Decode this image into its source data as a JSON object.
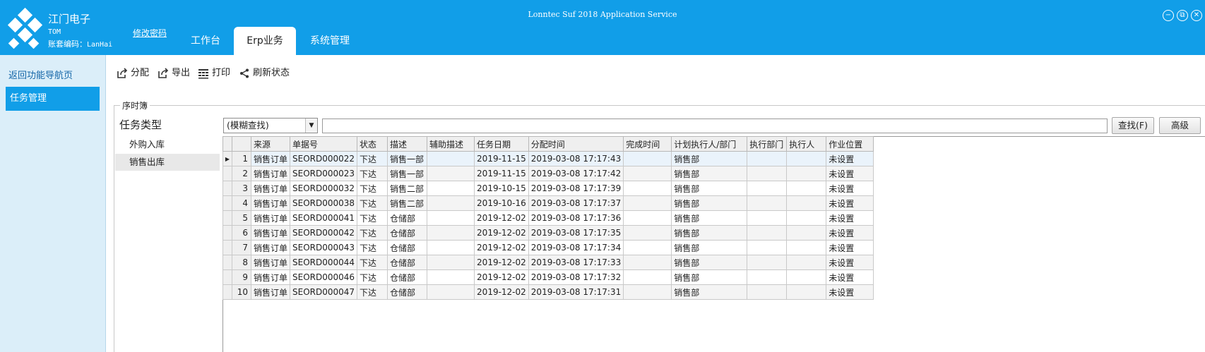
{
  "header": {
    "company": "江门电子",
    "user": "TOM",
    "account_label": "账套编码：",
    "account_code": "LanHai",
    "change_password": "修改密码",
    "app_title": "Lonntec Suf 2018 Application Service",
    "tabs": [
      {
        "label": "工作台",
        "active": false
      },
      {
        "label": "Erp业务",
        "active": true
      },
      {
        "label": "系统管理",
        "active": false
      }
    ],
    "window_buttons": {
      "minimize": "−",
      "restore": "⧉",
      "close": "✕"
    }
  },
  "leftnav": {
    "back": "返回功能导航页",
    "active_item": "任务管理"
  },
  "toolbar": {
    "items": [
      {
        "label": "分配",
        "icon": "share-icon"
      },
      {
        "label": "导出",
        "icon": "export-icon"
      },
      {
        "label": "打印",
        "icon": "print-icon"
      },
      {
        "label": "刷新状态",
        "icon": "refresh-share-icon"
      }
    ]
  },
  "group": {
    "title": "序时簿",
    "task_type_title": "任务类型",
    "task_types": [
      {
        "label": "外购入库",
        "selected": false
      },
      {
        "label": "销售出库",
        "selected": true
      }
    ]
  },
  "search": {
    "mode": "(模糊查找)",
    "value": "",
    "find_button": "查找(F)",
    "advanced_button": "高级"
  },
  "grid": {
    "columns": [
      "来源",
      "单据号",
      "状态",
      "描述",
      "辅助描述",
      "任务日期",
      "分配时间",
      "完成时间",
      "计划执行人/部门",
      "执行部门",
      "执行人",
      "作业位置"
    ],
    "rows": [
      {
        "no": "1",
        "cells": [
          "销售订单",
          "SEORD000022",
          "下达",
          "销售一部",
          "",
          "2019-11-15",
          "2019-03-08 17:17:43",
          "",
          "销售部",
          "",
          "",
          "未设置"
        ]
      },
      {
        "no": "2",
        "cells": [
          "销售订单",
          "SEORD000023",
          "下达",
          "销售一部",
          "",
          "2019-11-15",
          "2019-03-08 17:17:42",
          "",
          "销售部",
          "",
          "",
          "未设置"
        ]
      },
      {
        "no": "3",
        "cells": [
          "销售订单",
          "SEORD000032",
          "下达",
          "销售二部",
          "",
          "2019-10-15",
          "2019-03-08 17:17:39",
          "",
          "销售部",
          "",
          "",
          "未设置"
        ]
      },
      {
        "no": "4",
        "cells": [
          "销售订单",
          "SEORD000038",
          "下达",
          "销售二部",
          "",
          "2019-10-16",
          "2019-03-08 17:17:37",
          "",
          "销售部",
          "",
          "",
          "未设置"
        ]
      },
      {
        "no": "5",
        "cells": [
          "销售订单",
          "SEORD000041",
          "下达",
          "仓储部",
          "",
          "2019-12-02",
          "2019-03-08 17:17:36",
          "",
          "销售部",
          "",
          "",
          "未设置"
        ]
      },
      {
        "no": "6",
        "cells": [
          "销售订单",
          "SEORD000042",
          "下达",
          "仓储部",
          "",
          "2019-12-02",
          "2019-03-08 17:17:35",
          "",
          "销售部",
          "",
          "",
          "未设置"
        ]
      },
      {
        "no": "7",
        "cells": [
          "销售订单",
          "SEORD000043",
          "下达",
          "仓储部",
          "",
          "2019-12-02",
          "2019-03-08 17:17:34",
          "",
          "销售部",
          "",
          "",
          "未设置"
        ]
      },
      {
        "no": "8",
        "cells": [
          "销售订单",
          "SEORD000044",
          "下达",
          "仓储部",
          "",
          "2019-12-02",
          "2019-03-08 17:17:33",
          "",
          "销售部",
          "",
          "",
          "未设置"
        ]
      },
      {
        "no": "9",
        "cells": [
          "销售订单",
          "SEORD000046",
          "下达",
          "仓储部",
          "",
          "2019-12-02",
          "2019-03-08 17:17:32",
          "",
          "销售部",
          "",
          "",
          "未设置"
        ]
      },
      {
        "no": "10",
        "cells": [
          "销售订单",
          "SEORD000047",
          "下达",
          "仓储部",
          "",
          "2019-12-02",
          "2019-03-08 17:17:31",
          "",
          "销售部",
          "",
          "",
          "未设置"
        ]
      }
    ]
  },
  "colors": {
    "accent": "#119ee8",
    "nav_bg": "#dbeef9"
  }
}
